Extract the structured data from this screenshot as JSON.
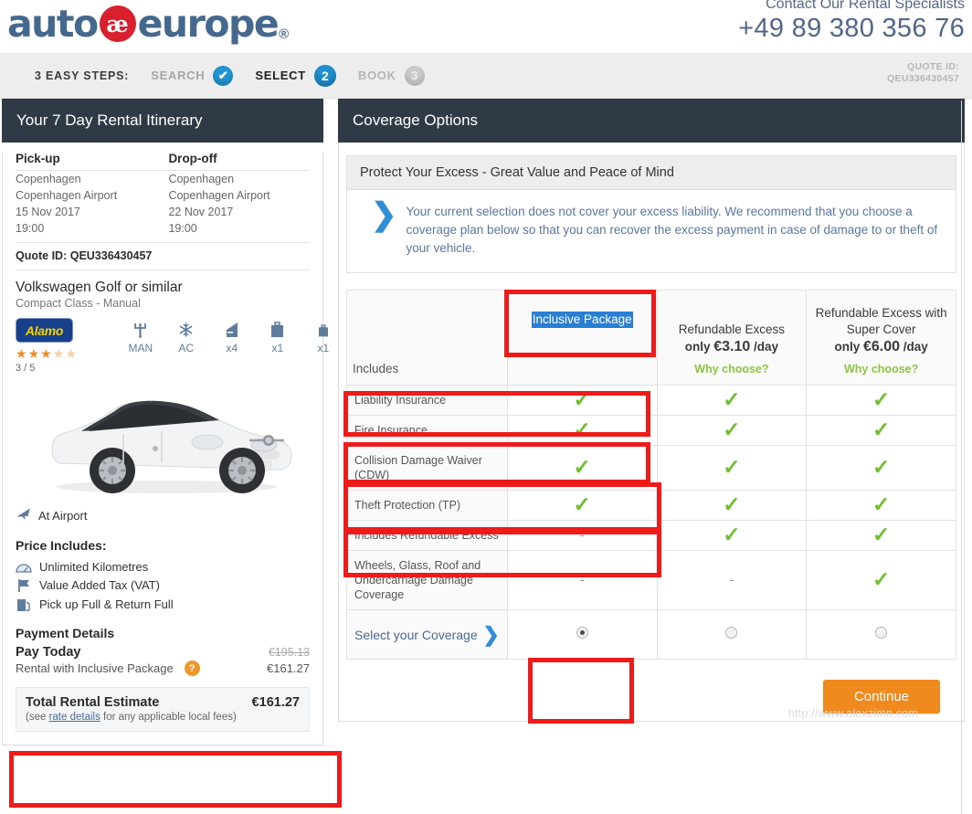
{
  "header": {
    "logo_text_1": "auto",
    "logo_mark": "æ",
    "logo_text_2": "europe",
    "logo_reg": "®",
    "contact_label": "Contact Our Rental Specialists",
    "contact_phone": "+49 89 380 356 76"
  },
  "steps": {
    "label": "3 EASY STEPS:",
    "items": [
      {
        "name": "SEARCH",
        "badge": "✔",
        "state": "done"
      },
      {
        "name": "SELECT",
        "badge": "2",
        "state": "current"
      },
      {
        "name": "BOOK",
        "badge": "3",
        "state": "todo"
      }
    ],
    "quote_id_label": "QUOTE ID:",
    "quote_id_value": "QEU336430457"
  },
  "sidebar": {
    "title": "Your 7 Day Rental Itinerary",
    "itinerary": {
      "col1_header": "Pick-up",
      "col2_header": "Drop-off",
      "rows": [
        {
          "pickup": "Copenhagen",
          "dropoff": "Copenhagen"
        },
        {
          "pickup": "Copenhagen Airport",
          "dropoff": "Copenhagen Airport"
        },
        {
          "pickup": "15 Nov 2017",
          "dropoff": "22 Nov 2017"
        },
        {
          "pickup": "19:00",
          "dropoff": "19:00"
        }
      ],
      "quote_row": "Quote ID: QEU336430457"
    },
    "car": {
      "title": "Volkswagen Golf or similar",
      "subtitle": "Compact Class - Manual",
      "vendor": "Alamo",
      "rating_stars_on": 3,
      "rating_stars_total": 5,
      "rating_text": "3 / 5",
      "features": [
        {
          "icon": "gearshift-icon",
          "glyph": "⑁",
          "caption": "MAN"
        },
        {
          "icon": "snowflake-icon",
          "glyph": "❄",
          "caption": "AC"
        },
        {
          "icon": "car-door-icon",
          "glyph": "◪",
          "caption": "x4"
        },
        {
          "icon": "large-suitcase-icon",
          "glyph": "🧳",
          "caption": "x1"
        },
        {
          "icon": "small-suitcase-icon",
          "glyph": "🧳",
          "caption": "x1"
        }
      ]
    },
    "at_airport": "At Airport",
    "price_includes_title": "Price Includes:",
    "price_includes": [
      {
        "icon": "speedometer-icon",
        "label": "Unlimited Kilometres"
      },
      {
        "icon": "flag-icon",
        "label": "Value Added Tax (VAT)"
      },
      {
        "icon": "fuel-pump-icon",
        "label": "Pick up Full & Return Full"
      }
    ],
    "payment_title": "Payment Details",
    "pay_today_label": "Pay Today",
    "pay_today_old": "€195.13",
    "pay_desc": "Rental with Inclusive Package",
    "pay_new": "€161.27",
    "total_label": "Total Rental Estimate",
    "total_sub_pre": "(see ",
    "total_sub_link": "rate details",
    "total_sub_post": " for any applicable local fees)",
    "total_amount": "€161.27"
  },
  "main": {
    "title": "Coverage Options",
    "promo_head": "Protect Your Excess - Great Value and Peace of Mind",
    "promo_text": "Your current selection does not cover your excess liability. We recommend that you choose a coverage plan below so that you can recover the excess payment in case of damage to or theft of your vehicle.",
    "table": {
      "includes_label": "Includes",
      "plans": [
        {
          "name": "Inclusive Package",
          "price_prefix": "",
          "price": "",
          "price_suffix": "",
          "why": "",
          "selected_name": true
        },
        {
          "name": "Refundable Excess",
          "price_prefix": "only ",
          "price": "€3.10",
          "price_suffix": " /day",
          "why": "Why choose?",
          "selected_name": false
        },
        {
          "name": "Refundable Excess with Super Cover",
          "price_prefix": "only ",
          "price": "€6.00",
          "price_suffix": " /day",
          "why": "Why choose?",
          "selected_name": false
        }
      ],
      "rows": [
        {
          "feature": "Liability Insurance",
          "values": [
            "check",
            "check",
            "check"
          ]
        },
        {
          "feature": "Fire Insurance",
          "values": [
            "check",
            "check",
            "check"
          ]
        },
        {
          "feature": "Collision Damage Waiver (CDW)",
          "values": [
            "check",
            "check",
            "check"
          ]
        },
        {
          "feature": "Theft Protection (TP)",
          "values": [
            "check",
            "check",
            "check"
          ]
        },
        {
          "feature": "Includes Refundable Excess",
          "values": [
            "dash",
            "check",
            "check"
          ]
        },
        {
          "feature": "Wheels, Glass, Roof and Undercarriage Damage Coverage",
          "values": [
            "dash",
            "dash",
            "check"
          ]
        }
      ],
      "select_row_label": "Select your Coverage",
      "selected_plan_index": 0
    },
    "continue_label": "Continue",
    "watermark": "http://www.alexzimn.com"
  },
  "colors": {
    "brand_blue": "#45688e",
    "accent_orange": "#f08a1e",
    "panel_dark": "#303a47",
    "tick_green": "#6fbf2f",
    "why_green": "#8cc63f",
    "annotation_red": "#ef1b1b",
    "select_highlight": "#2a7fd4"
  }
}
